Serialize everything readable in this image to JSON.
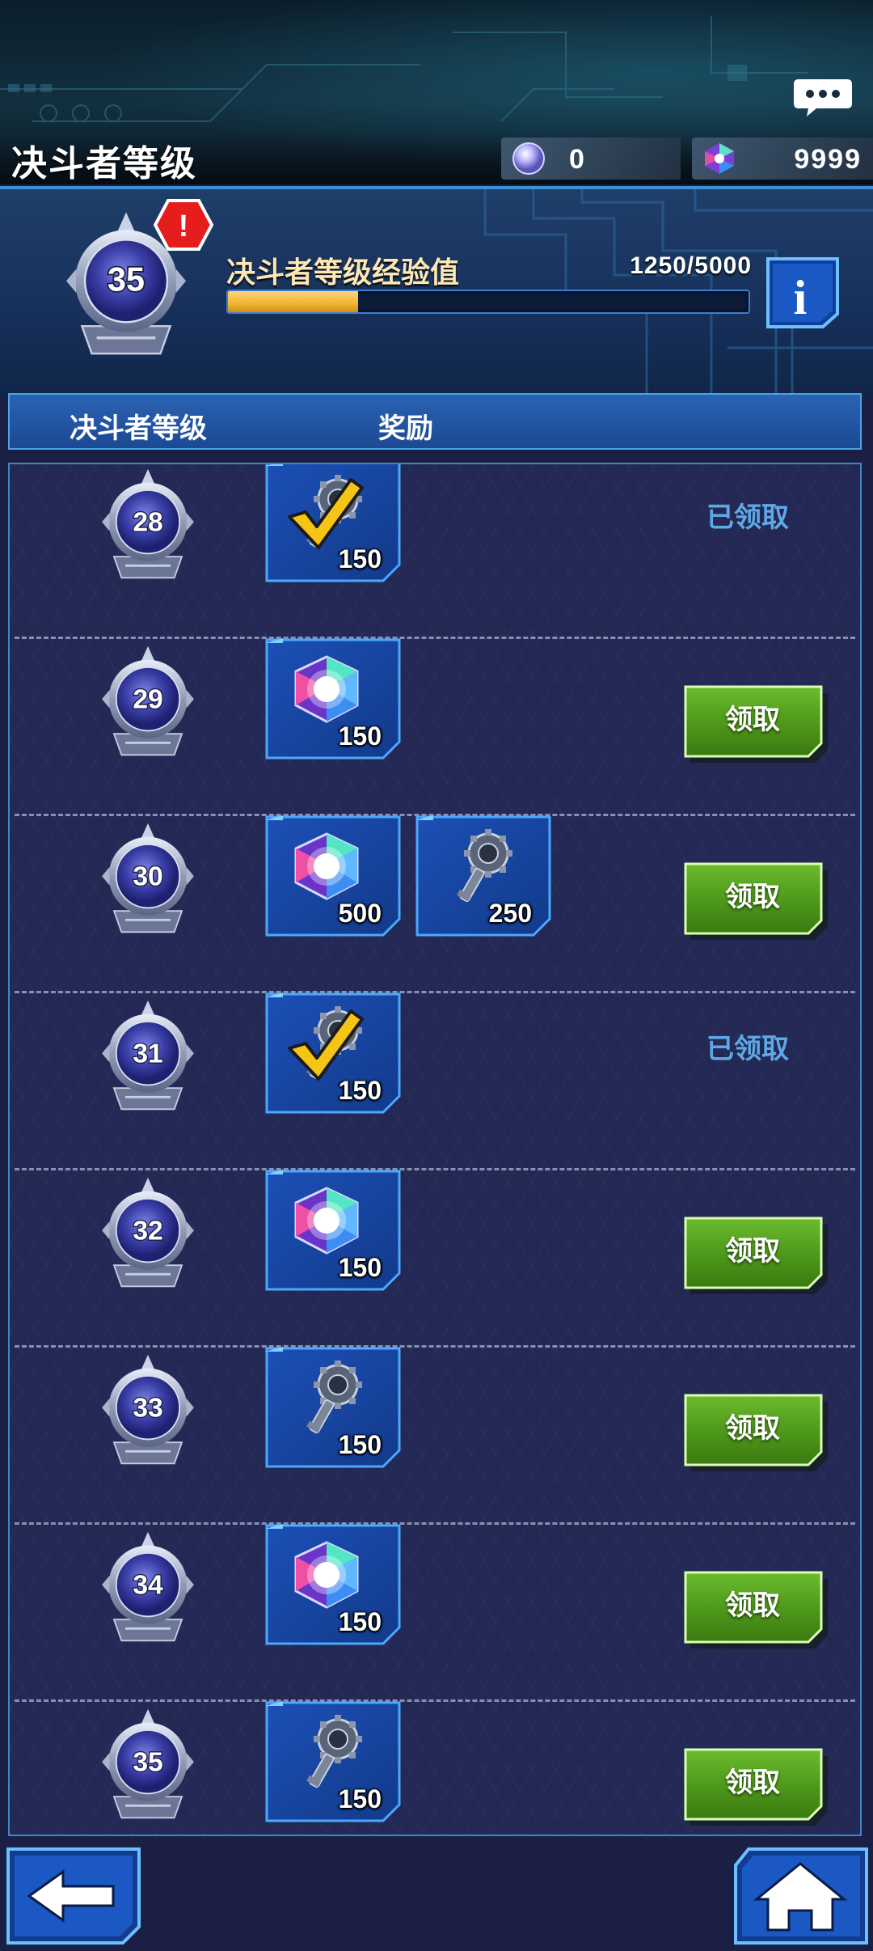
{
  "header": {
    "title": "决斗者等级",
    "chat_icon": "chat-bubble-icon",
    "currencies": [
      {
        "name": "orb",
        "icon": "orb-icon",
        "value": "0"
      },
      {
        "name": "gem",
        "icon": "gem-icon",
        "value": "9999"
      }
    ]
  },
  "level_panel": {
    "current_level": "35",
    "alert_icon": "exclamation-icon",
    "alert_text": "!",
    "exp_label": "决斗者等级经验值",
    "exp_value": "1250/5000",
    "exp_progress": 0.25,
    "info_icon": "info-icon",
    "info_text": "i"
  },
  "table": {
    "col_level": "决斗者等级",
    "col_reward": "奖励"
  },
  "rewards": [
    {
      "level": "28",
      "items": [
        {
          "icon": "key-icon",
          "checked": true,
          "qty": "150"
        }
      ],
      "status": "claimed",
      "status_text": "已领取"
    },
    {
      "level": "29",
      "items": [
        {
          "icon": "gem-icon",
          "checked": false,
          "qty": "150"
        }
      ],
      "status": "claimable",
      "status_text": "领取"
    },
    {
      "level": "30",
      "items": [
        {
          "icon": "gem-icon",
          "checked": false,
          "qty": "500"
        },
        {
          "icon": "key-icon",
          "checked": false,
          "qty": "250"
        }
      ],
      "status": "claimable",
      "status_text": "领取"
    },
    {
      "level": "31",
      "items": [
        {
          "icon": "key-icon",
          "checked": true,
          "qty": "150"
        }
      ],
      "status": "claimed",
      "status_text": "已领取"
    },
    {
      "level": "32",
      "items": [
        {
          "icon": "gem-icon",
          "checked": false,
          "qty": "150"
        }
      ],
      "status": "claimable",
      "status_text": "领取"
    },
    {
      "level": "33",
      "items": [
        {
          "icon": "key-icon",
          "checked": false,
          "qty": "150"
        }
      ],
      "status": "claimable",
      "status_text": "领取"
    },
    {
      "level": "34",
      "items": [
        {
          "icon": "gem-icon",
          "checked": false,
          "qty": "150"
        }
      ],
      "status": "claimable",
      "status_text": "领取"
    },
    {
      "level": "35",
      "items": [
        {
          "icon": "key-icon",
          "checked": false,
          "qty": "150"
        }
      ],
      "status": "claimable",
      "status_text": "领取"
    }
  ],
  "footer": {
    "back_icon": "back-arrow-icon",
    "home_icon": "home-icon"
  },
  "colors": {
    "accent_blue": "#3e86c9",
    "claim_green": "#4f9a1c",
    "claimed_text": "#5fa8e6",
    "exp_fill": "#f0b432"
  }
}
